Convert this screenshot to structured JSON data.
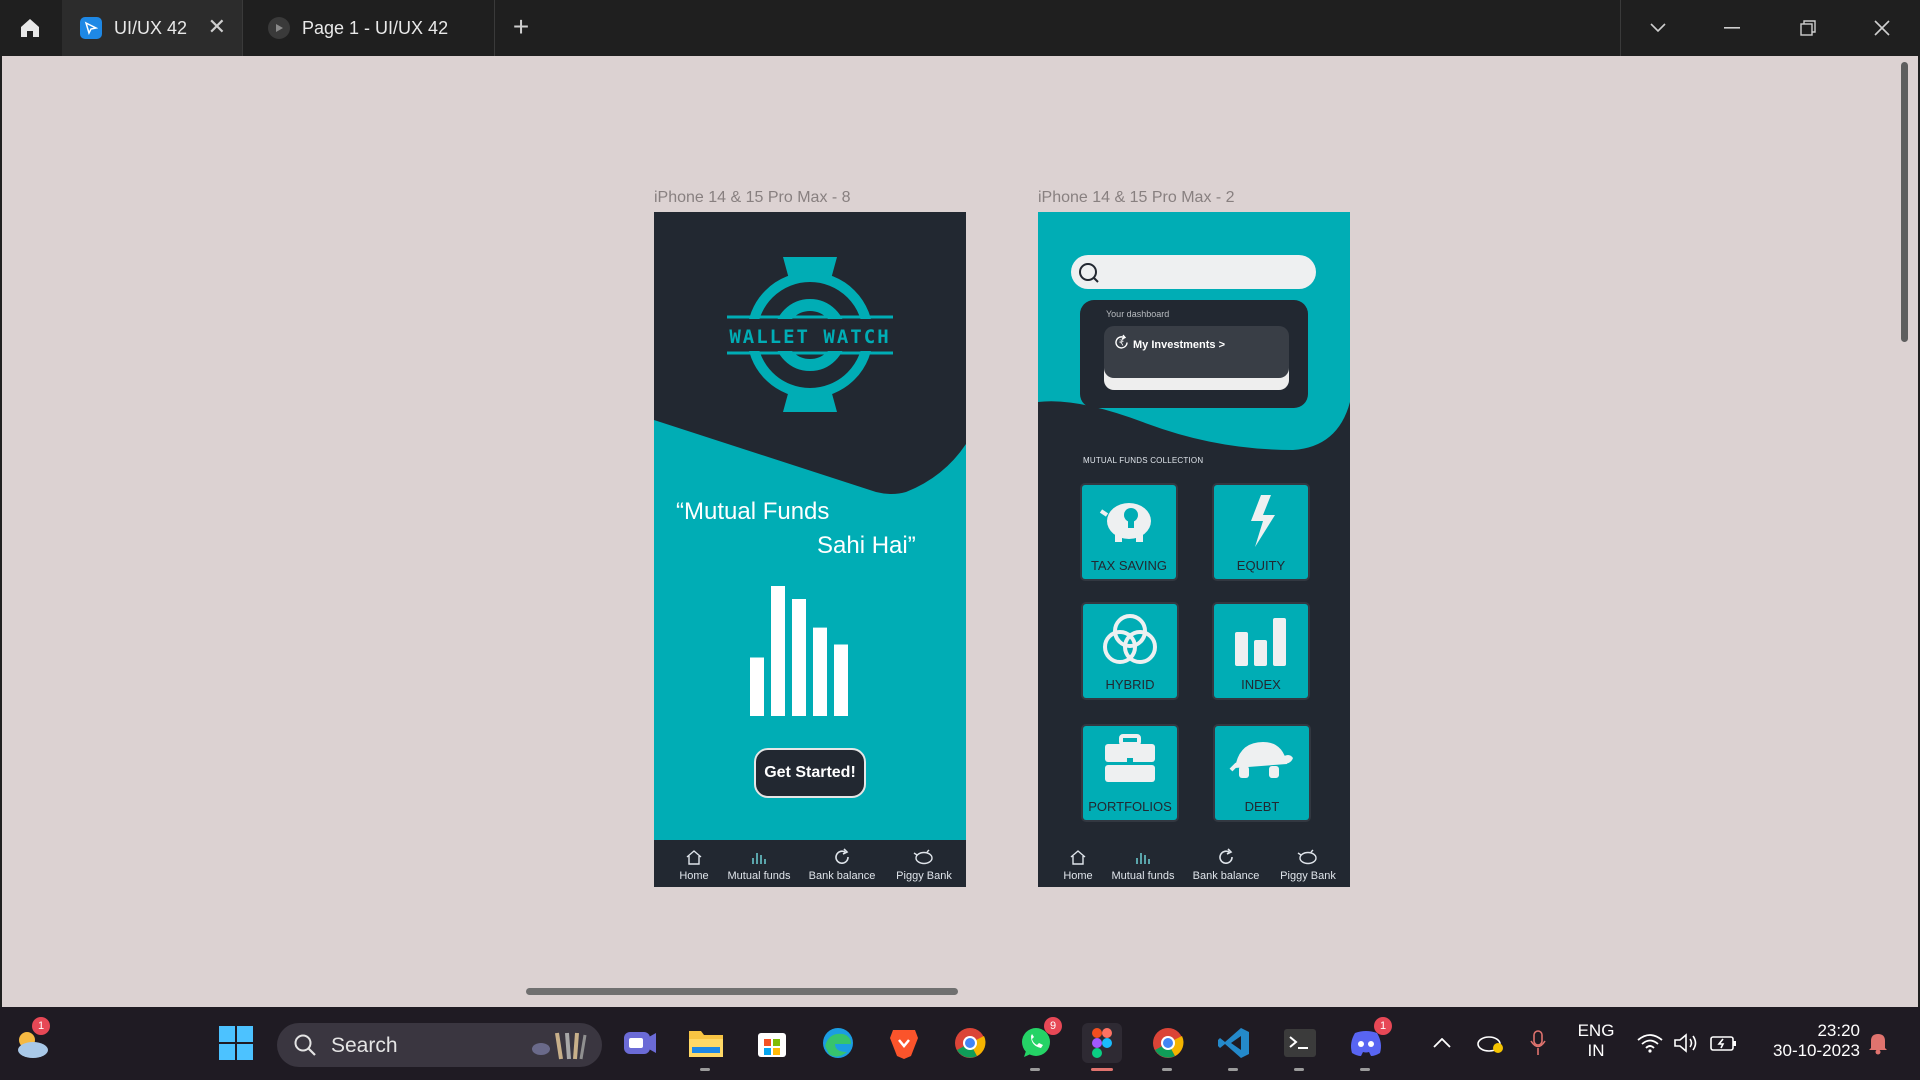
{
  "titlebar": {
    "tabs": [
      {
        "label": "UI/UX 42",
        "active": true,
        "close": "✕"
      },
      {
        "label": "Page 1 - UI/UX 42",
        "active": false
      }
    ],
    "new_tab": "+"
  },
  "frames": [
    {
      "label": "iPhone 14 & 15 Pro Max - 8"
    },
    {
      "label": "iPhone 14 & 15 Pro Max - 2"
    }
  ],
  "screen1": {
    "logo_text": "WALLET WATCH",
    "quote_line1": "“Mutual Funds",
    "quote_line2": "Sahi Hai”",
    "cta": "Get Started!",
    "chart_bars": [
      0.45,
      1.0,
      0.9,
      0.68,
      0.55
    ]
  },
  "screen2": {
    "search_placeholder": "",
    "dashboard_label": "Your dashboard",
    "investments_label": "My Investments >",
    "section_label": "MUTUAL FUNDS COLLECTION",
    "tiles": [
      {
        "label": "TAX SAVING",
        "icon": "piggy-bank-icon"
      },
      {
        "label": "EQUITY",
        "icon": "lightning-icon"
      },
      {
        "label": "HYBRID",
        "icon": "rings-icon"
      },
      {
        "label": "INDEX",
        "icon": "bar-chart-icon"
      },
      {
        "label": "PORTFOLIOS",
        "icon": "briefcase-icon"
      },
      {
        "label": "DEBT",
        "icon": "turtle-icon"
      }
    ]
  },
  "navbar": {
    "items": [
      {
        "label": "Home",
        "icon": "home-icon"
      },
      {
        "label": "Mutual funds",
        "icon": "bar-chart-icon"
      },
      {
        "label": "Bank balance",
        "icon": "refresh-icon"
      },
      {
        "label": "Piggy Bank",
        "icon": "piggy-bank-icon"
      }
    ]
  },
  "taskbar": {
    "weather_badge": "1",
    "search_label": "Search",
    "whatsapp_badge": "9",
    "discord_badge": "1",
    "lang_line1": "ENG",
    "lang_line2": "IN",
    "time": "23:20",
    "date": "30-10-2023"
  },
  "colors": {
    "teal": "#00adb5",
    "dark": "#222831",
    "card": "#393e46",
    "canvas": "#dcd2d2"
  }
}
